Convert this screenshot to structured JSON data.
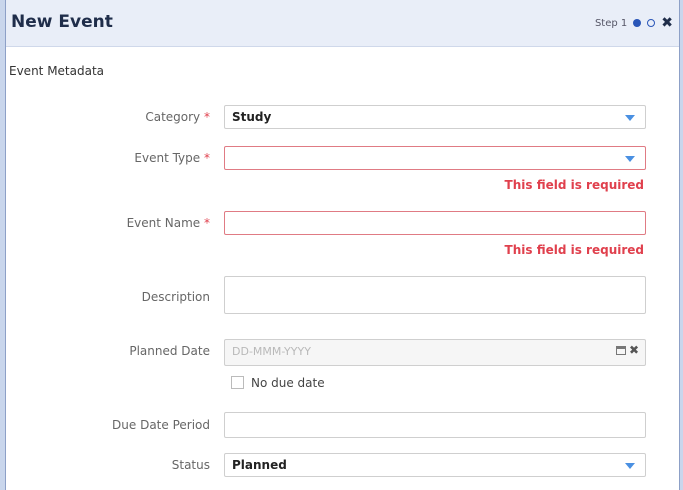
{
  "dialog": {
    "title": "New Event",
    "step_label": "Step 1",
    "section_title": "Event Metadata"
  },
  "fields": {
    "category": {
      "label": "Category",
      "required_mark": "*",
      "value": "Study"
    },
    "event_type": {
      "label": "Event Type",
      "required_mark": "*",
      "value": "",
      "error": "This field is required"
    },
    "event_name": {
      "label": "Event Name",
      "required_mark": "*",
      "value": "",
      "error": "This field is required"
    },
    "description": {
      "label": "Description",
      "value": ""
    },
    "planned_date": {
      "label": "Planned Date",
      "placeholder": "DD-MMM-YYYY"
    },
    "no_due_date": {
      "label": "No due date",
      "checked": false
    },
    "due_date_period": {
      "label": "Due Date Period",
      "value": ""
    },
    "status": {
      "label": "Status",
      "value": "Planned"
    }
  },
  "icons": {
    "close": "close-icon",
    "step_current": "step-filled-dot-icon",
    "step_next": "step-empty-dot-icon",
    "dropdown": "caret-down-icon",
    "calendar": "calendar-icon",
    "clear": "clear-icon"
  },
  "colors": {
    "accent": "#4a90e2",
    "error": "#e0404d",
    "required": "#e0404d",
    "titlebar_bg": "#e9eef8"
  }
}
